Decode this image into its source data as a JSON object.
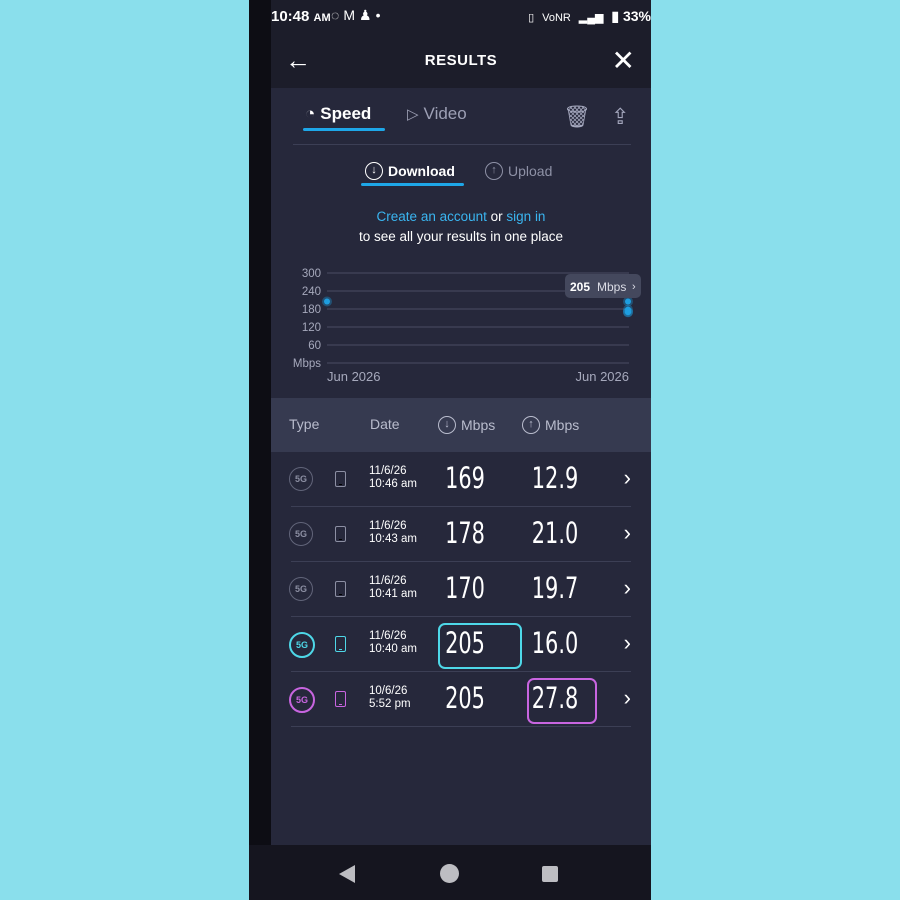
{
  "status": {
    "time": "10:48",
    "ampm": "AM",
    "left_icons": [
      "whatsapp-icon",
      "gmail-icon",
      "account-icon",
      "dot-icon"
    ],
    "right_text": "VoNR",
    "battery": "33%"
  },
  "appbar": {
    "title": "RESULTS"
  },
  "tabs": [
    {
      "label": "Speed",
      "icon": "speedometer-icon",
      "active": true
    },
    {
      "label": "Video",
      "icon": "play-icon",
      "active": false
    }
  ],
  "subtabs": [
    {
      "label": "Download",
      "icon": "↓",
      "active": true
    },
    {
      "label": "Upload",
      "icon": "↑",
      "active": false
    }
  ],
  "account": {
    "create_link": "Create an account",
    "or": "or",
    "signin_link": "sign in",
    "line2": "to see all your results in one place"
  },
  "chart_data": {
    "type": "scatter",
    "y_ticks": [
      "300",
      "240",
      "180",
      "120",
      "60"
    ],
    "ylabel": "Mbps",
    "ylim": [
      0,
      300
    ],
    "x_labels": [
      "Jun 2026",
      "Jun 2026"
    ],
    "points": [
      {
        "x": "10/6/26 5:52 pm",
        "y": 205
      },
      {
        "x": "11/6/26 10:40 am",
        "y": 205
      },
      {
        "x": "11/6/26 10:41 am",
        "y": 170
      },
      {
        "x": "11/6/26 10:43 am",
        "y": 178
      },
      {
        "x": "11/6/26 10:46 am",
        "y": 169
      }
    ],
    "tooltip_value": "205",
    "tooltip_unit": "Mbps",
    "color": "#1e9ee0"
  },
  "table": {
    "headers": {
      "type": "Type",
      "date": "Date",
      "download": "Mbps",
      "upload": "Mbps"
    },
    "rows": [
      {
        "network": "5G",
        "date": "11/6/26",
        "time": "10:46 am",
        "download": "169",
        "upload": "12.9",
        "highlight": ""
      },
      {
        "network": "5G",
        "date": "11/6/26",
        "time": "10:43 am",
        "download": "178",
        "upload": "21.0",
        "highlight": ""
      },
      {
        "network": "5G",
        "date": "11/6/26",
        "time": "10:41 am",
        "download": "170",
        "upload": "19.7",
        "highlight": ""
      },
      {
        "network": "5G",
        "date": "11/6/26",
        "time": "10:40 am",
        "download": "205",
        "upload": "16.0",
        "highlight": "cyan"
      },
      {
        "network": "5G",
        "date": "10/6/26",
        "time": "5:52 pm",
        "download": "205",
        "upload": "27.8",
        "highlight": "purple"
      }
    ]
  },
  "colors": {
    "accent": "#1ea7e8",
    "cyan": "#4ed8e8",
    "purple": "#c865e0",
    "background": "#26283b",
    "page_bg": "#8adfec"
  }
}
